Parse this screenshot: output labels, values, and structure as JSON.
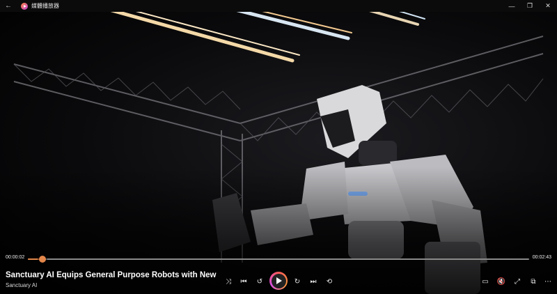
{
  "window": {
    "title": "媒體播放器",
    "back_icon": "←",
    "minimize_icon": "—",
    "restore_icon": "❐",
    "close_icon": "✕"
  },
  "player": {
    "current_time": "00:00:02",
    "duration": "00:02:43",
    "progress": 0.012,
    "media_title": "Sanctuary AI Equips General Purpose Robots with New Touch...",
    "artist": "Sanctuary AI",
    "accent_color": "#e2864a"
  },
  "controls": {
    "shuffle_icon": "⤨",
    "previous_icon": "⏮",
    "rewind_icon": "↺",
    "forward_icon": "↻",
    "next_icon": "⏭",
    "repeat_icon": "⟲",
    "captions_icon": "▭",
    "volume_icon": "🔇",
    "fullscreen_icon": "⤢",
    "miniplayer_icon": "⧉",
    "more_icon": "⋯"
  }
}
